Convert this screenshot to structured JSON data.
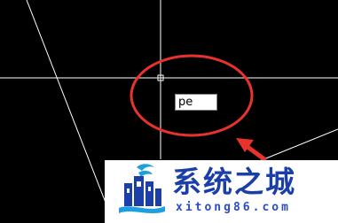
{
  "command_line": {
    "value": "pe"
  },
  "watermark": {
    "name": "系统之城",
    "domain": "xitong86.com"
  },
  "colors": {
    "canvas_background": "#000000",
    "geometry_lines": "#ffffff",
    "annotation_red": "#e8322c",
    "watermark_blue": "#1a3fa8"
  }
}
